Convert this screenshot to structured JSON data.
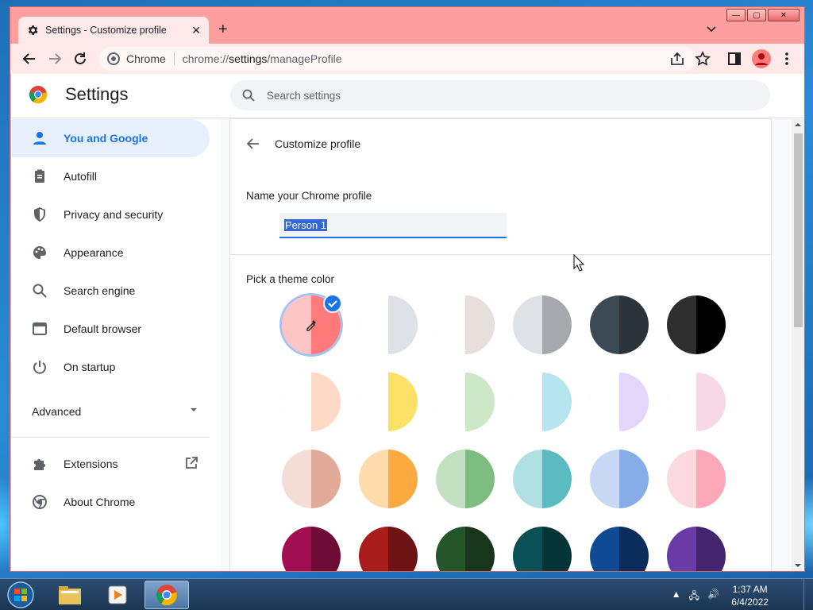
{
  "window": {
    "tab_title": "Settings - Customize profile",
    "new_tab": "+",
    "close_tab": "✕",
    "caption": {
      "minimize": "—",
      "maximize": "▢",
      "close": "✕"
    }
  },
  "omnibox": {
    "chip": "Chrome",
    "url_scheme": "chrome://",
    "url_host": "settings",
    "url_path": "/manageProfile"
  },
  "settings": {
    "title": "Settings",
    "search_placeholder": "Search settings"
  },
  "sidebar": {
    "items": [
      {
        "label": "You and Google",
        "icon": "person-icon",
        "active": true
      },
      {
        "label": "Autofill",
        "icon": "clipboard-icon"
      },
      {
        "label": "Privacy and security",
        "icon": "shield-icon"
      },
      {
        "label": "Appearance",
        "icon": "palette-icon"
      },
      {
        "label": "Search engine",
        "icon": "search-icon"
      },
      {
        "label": "Default browser",
        "icon": "browser-icon"
      },
      {
        "label": "On startup",
        "icon": "power-icon"
      }
    ],
    "advanced": "Advanced",
    "extensions": "Extensions",
    "about": "About Chrome"
  },
  "main": {
    "page_title": "Customize profile",
    "name_label": "Name your Chrome profile",
    "name_value": "Person 1",
    "theme_label": "Pick a theme color"
  },
  "themes": [
    {
      "left": "#ffc5c5",
      "right": "#ff7b7b",
      "selected": true,
      "custom": true
    },
    {
      "left": "#ffffff",
      "right": "#dee1e6"
    },
    {
      "left": "#ffffff",
      "right": "#e6dfdc"
    },
    {
      "left": "#dee1e6",
      "right": "#a6a8ae"
    },
    {
      "left": "#3c4a55",
      "right": "#2c343b"
    },
    {
      "left": "#2f2f2f",
      "right": "#000000"
    },
    {
      "left": "#ffffff",
      "right": "#fdd9c6"
    },
    {
      "left": "#ffffff",
      "right": "#fde167"
    },
    {
      "left": "#ffffff",
      "right": "#cde8c7"
    },
    {
      "left": "#ffffff",
      "right": "#b6e5f0"
    },
    {
      "left": "#ffffff",
      "right": "#e4d5fb"
    },
    {
      "left": "#ffffff",
      "right": "#f7d9e5"
    },
    {
      "left": "#f3ddd5",
      "right": "#e2aa99"
    },
    {
      "left": "#fddbab",
      "right": "#fca942"
    },
    {
      "left": "#c3e0c1",
      "right": "#7dbd7f"
    },
    {
      "left": "#b1e0e4",
      "right": "#5cbac1"
    },
    {
      "left": "#c7d9f5",
      "right": "#86ade8"
    },
    {
      "left": "#fbd9df",
      "right": "#fca8b9"
    },
    {
      "left": "#a10e52",
      "right": "#6d0b36"
    },
    {
      "left": "#a81c1c",
      "right": "#6e1313"
    },
    {
      "left": "#24562a",
      "right": "#18361c"
    },
    {
      "left": "#0a5156",
      "right": "#053436"
    },
    {
      "left": "#0f4b95",
      "right": "#0b2d5e"
    },
    {
      "left": "#6a3aa6",
      "right": "#43266e"
    }
  ],
  "taskbar": {
    "time": "1:37 AM",
    "date": "6/4/2022"
  }
}
